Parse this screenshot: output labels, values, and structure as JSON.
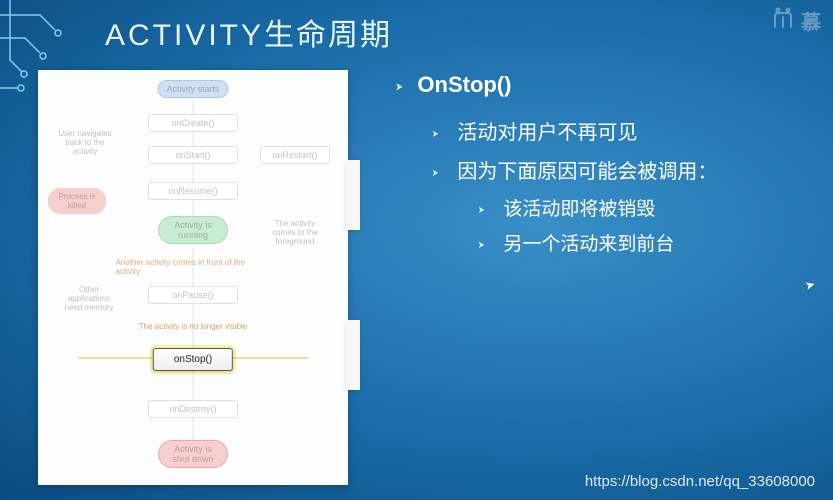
{
  "title": {
    "eng": "ACTIVITY",
    "chn": "生命周期"
  },
  "logo_text": "慕",
  "diagram": {
    "start": "Activity starts",
    "onCreate": "onCreate()",
    "onStart": "onStart()",
    "onRestart": "onRestart()",
    "nav_back": "User navigates back to the activity",
    "onResume": "onResume()",
    "running": "Activity is running",
    "comes_fg": "The activity comes to the foreground",
    "process_killed": "Process is killed",
    "another": "Another activity comes in front of the activity",
    "need_mem": "Other applications need memory",
    "onPause": "onPause()",
    "no_longer": "The activity is no longer visible",
    "onStop": "onStop()",
    "onDestroy": "onDestroy()",
    "shutdown": "Activity is shut down"
  },
  "content": {
    "h1": "OnStop()",
    "p1": "活动对用户不再可见",
    "p2": "因为下面原因可能会被调用：",
    "p2a": "该活动即将被销毁",
    "p2b": "另一个活动来到前台"
  },
  "watermark": "https://blog.csdn.net/qq_33608000"
}
